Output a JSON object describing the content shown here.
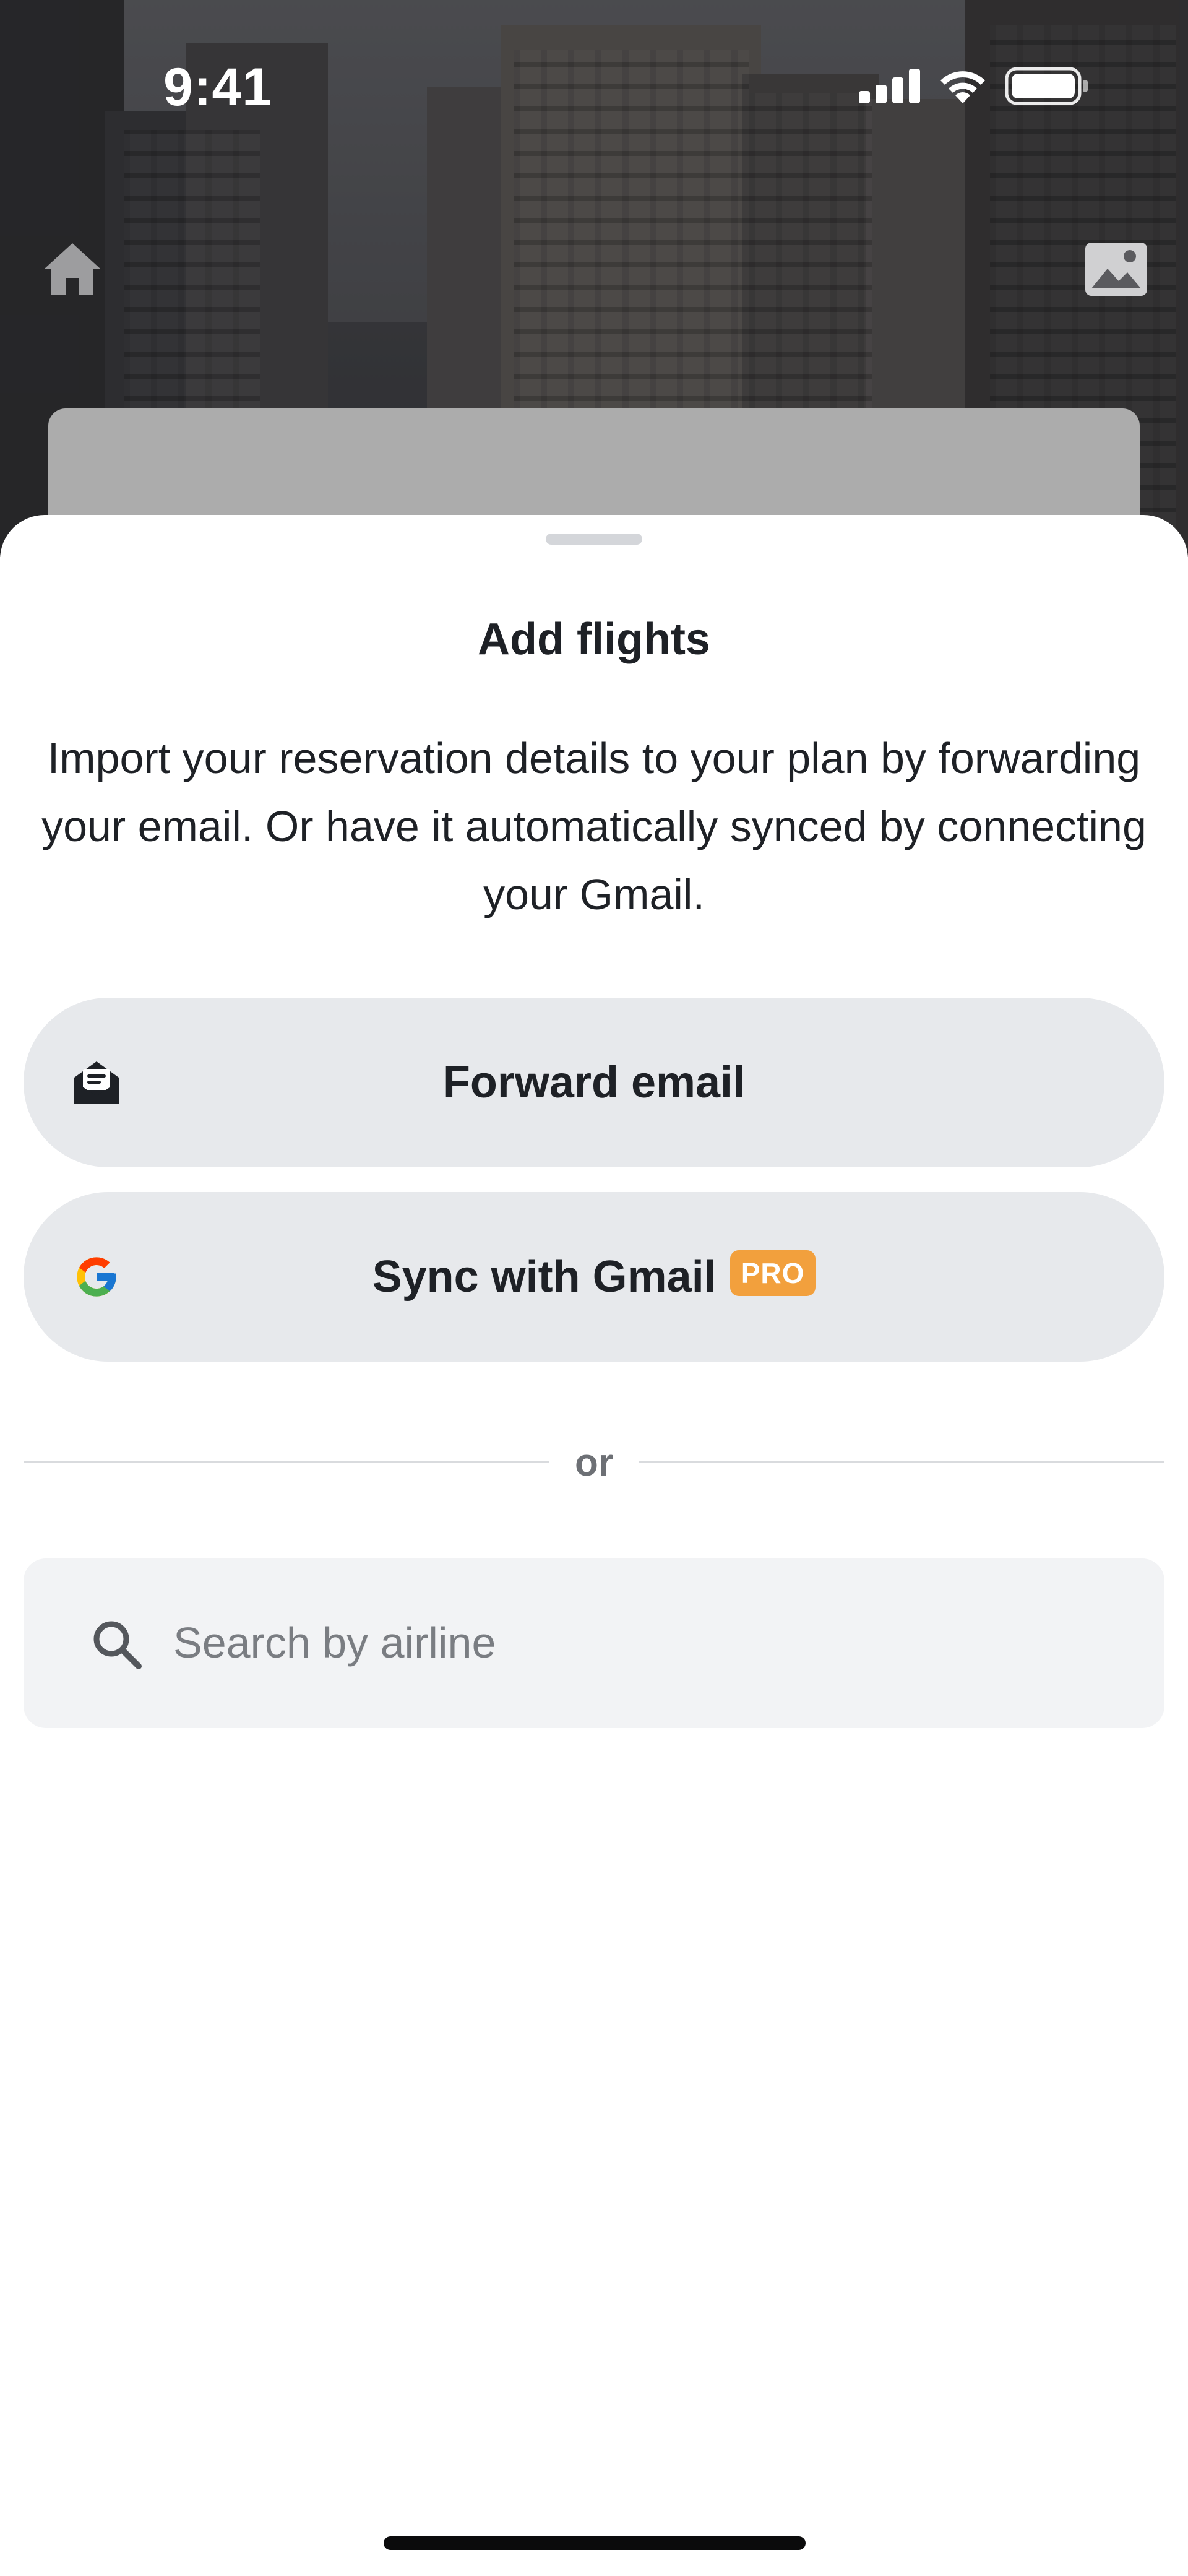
{
  "status_bar": {
    "time": "9:41",
    "signal_icon": "cellular-signal-icon",
    "wifi_icon": "wifi-icon",
    "battery_icon": "battery-icon"
  },
  "top_bar": {
    "home_icon": "home-icon",
    "image_icon": "image-icon"
  },
  "sheet": {
    "title": "Add flights",
    "description": "Import your reservation details to your plan by forwarding your email. Or have it automatically synced by connecting your Gmail.",
    "forward_button": {
      "label": "Forward email",
      "icon": "open-envelope-icon"
    },
    "gmail_button": {
      "label": "Sync with Gmail",
      "badge": "PRO",
      "icon": "google-icon"
    },
    "divider_text": "or",
    "search": {
      "placeholder": "Search by airline",
      "value": "",
      "icon": "search-icon"
    }
  },
  "colors": {
    "pill_background": "#e7e9ec",
    "search_background": "#f2f3f5",
    "pro_badge": "#f2a03d",
    "text_primary": "#1e2126",
    "text_muted": "#6d7075"
  }
}
